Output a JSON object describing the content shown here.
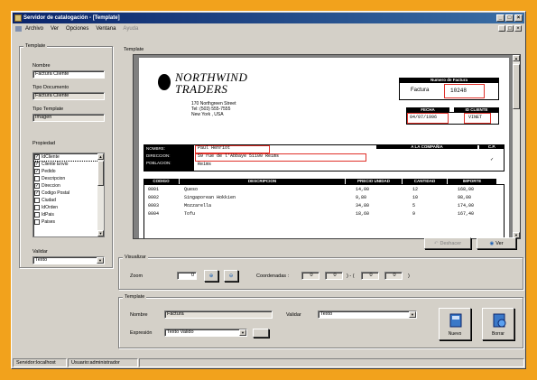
{
  "window": {
    "title": "Servidor de catalogación - [Template]"
  },
  "menu": [
    "Archivo",
    "Ver",
    "Opciones",
    "Ventana",
    "Ayuda"
  ],
  "left": {
    "template_group": "Template",
    "nombre_label": "Nombre",
    "nombre_value": "Factura Cliente",
    "tipo_doc_label": "Tipo Documento",
    "tipo_doc_value": "Factura Cliente",
    "tipo_tpl_label": "Tipo Template",
    "tipo_tpl_value": "Imagen",
    "propiedad_label": "Propiedad",
    "propiedades": [
      {
        "label": "IdCliente",
        "checked": true,
        "selected": true
      },
      {
        "label": "Cliente Envio",
        "checked": true
      },
      {
        "label": "Pedido",
        "checked": true
      },
      {
        "label": "Descripcion",
        "checked": false
      },
      {
        "label": "Direccion",
        "checked": true
      },
      {
        "label": "Codigo Postal",
        "checked": true
      },
      {
        "label": "Ciudad",
        "checked": false
      },
      {
        "label": "IdOrden",
        "checked": false
      },
      {
        "label": "IdPais",
        "checked": false
      },
      {
        "label": "Paises",
        "checked": false
      }
    ],
    "validar_label": "Validar",
    "validar_value": "Texto"
  },
  "preview": {
    "group": "Template",
    "logo_line1": "NORTHWIND",
    "logo_line2": "TRADERS",
    "address": [
      "170 Northgreen Street",
      "Tel: (503) 555-7555",
      "New York , USA"
    ],
    "invoice_hdr": "Numero de Factura",
    "factura_label": "Factura",
    "factura_num": "10248",
    "fecha_hdr": "FECHA",
    "idcliente_hdr": "ID CLIENTE",
    "fecha_val": "04/07/1996",
    "idcliente_val": "VINET",
    "cust_labels": [
      "NOMBRE:",
      "DIRECCION:",
      "POBLACION:"
    ],
    "cust_values": [
      "Paul Henriot",
      "59 rue de l'Abbaye 51100 Reims",
      "Reims"
    ],
    "cust_hdr2": "A LA COMPAÑIA",
    "cust_hdr3": "C.P.",
    "table_headers": [
      "CODIGO",
      "DESCRIPCION",
      "PRECIO UNIDAD",
      "CANTIDAD",
      "IMPORTE"
    ],
    "rows": [
      [
        "0001",
        "Queso",
        "14,00",
        "12",
        "168,00"
      ],
      [
        "0002",
        "Singaporean Hokkien",
        "9,80",
        "10",
        "98,00"
      ],
      [
        "0003",
        "Mozzarella",
        "34,80",
        "5",
        "174,00"
      ],
      [
        "0004",
        "Tofu",
        "18,60",
        "9",
        "167,40"
      ]
    ],
    "btn_deshacer": "Deshacer",
    "btn_ver": "Ver"
  },
  "viewer": {
    "group": "Visualizar",
    "zoom_label": "Zoom",
    "zoom_value": "0",
    "coords_label": "Coordenadas :",
    "coords": [
      "0",
      "0",
      "0",
      "0"
    ]
  },
  "bottom": {
    "group": "Template",
    "nombre_label": "Nombre",
    "nombre_value": "Factura",
    "validar_label": "Validar",
    "validar_value": "Texto",
    "expresion_label": "Expresión",
    "expresion_value": "Texto Valido",
    "btn_nuevo": "Nuevo",
    "btn_borrar": "Borrar"
  },
  "status": [
    "Servidor:localhost",
    "Usuario:administrador"
  ]
}
